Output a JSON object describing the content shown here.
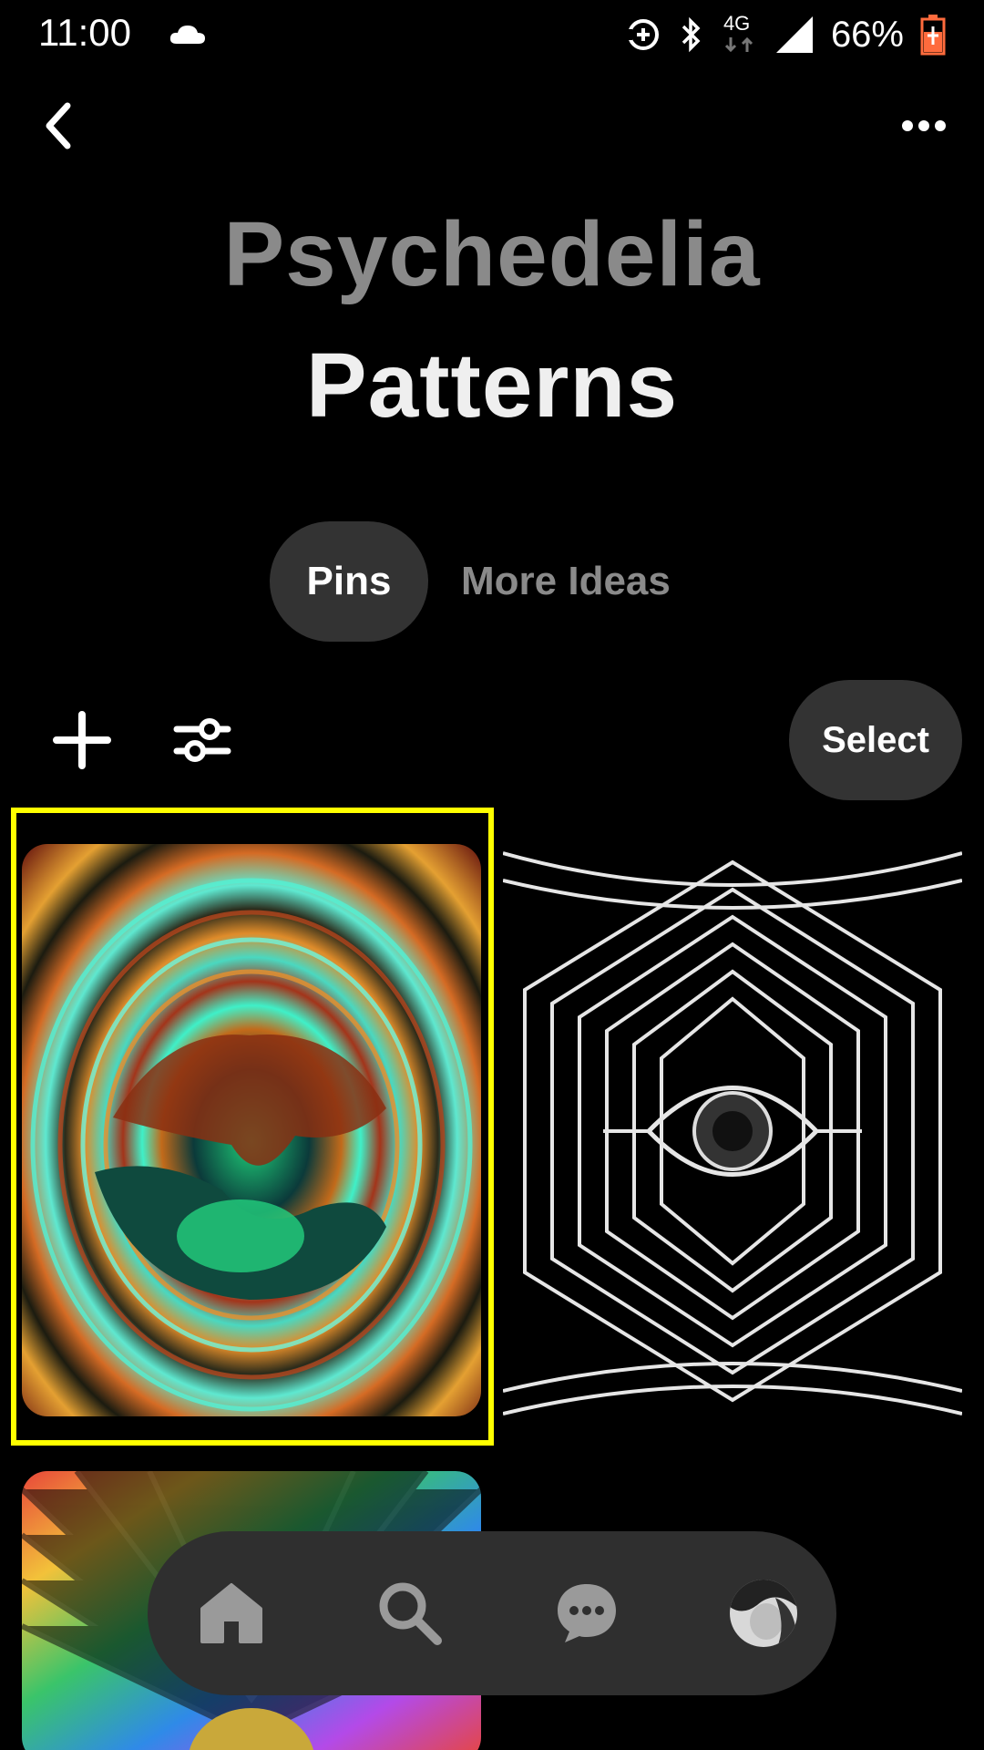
{
  "status_bar": {
    "time": "11:00",
    "network": "4G",
    "battery": "66%",
    "icons": [
      "cloud-icon",
      "sync-icon",
      "bluetooth-icon",
      "data-arrows-icon",
      "signal-icon",
      "battery-charging-icon"
    ]
  },
  "header": {
    "back_icon": "chevron-left-icon",
    "more_icon": "more-dots-icon"
  },
  "board": {
    "section_name": "Psychedelia",
    "title": "Patterns"
  },
  "tabs": [
    {
      "label": "Pins",
      "selected": true
    },
    {
      "label": "More Ideas",
      "selected": false
    }
  ],
  "toolbar": {
    "add_icon": "plus-icon",
    "filter_icon": "sliders-icon",
    "select_label": "Select"
  },
  "pins": [
    {
      "name": "pin-fractal-swirl",
      "highlighted": true
    },
    {
      "name": "pin-eye-lines"
    },
    {
      "name": "pin-rainbow-rays"
    }
  ],
  "bottom_nav": [
    {
      "name": "home",
      "icon": "home-icon",
      "selected": true
    },
    {
      "name": "search",
      "icon": "search-icon"
    },
    {
      "name": "messages",
      "icon": "chat-bubble-icon"
    },
    {
      "name": "profile",
      "icon": "avatar"
    }
  ],
  "colors": {
    "background": "#000000",
    "pill": "#333333",
    "highlight": "#ffff00",
    "muted_text": "#8a8a8a"
  }
}
